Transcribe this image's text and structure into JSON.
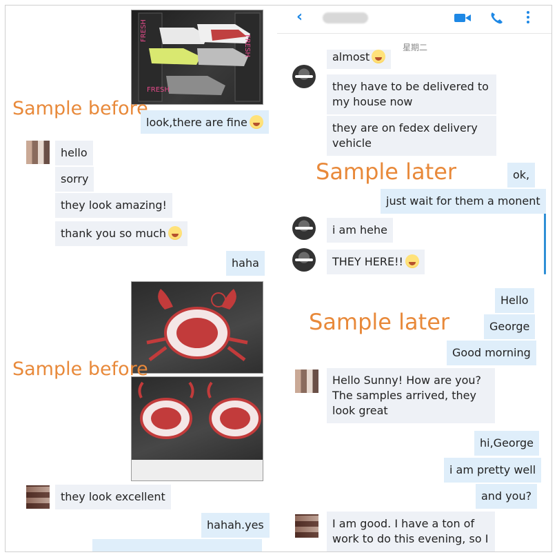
{
  "colors": {
    "caption": "#e8893a",
    "accent": "#1e88e5",
    "bubble_in": "#eef1f6",
    "bubble_out": "#dfeefa"
  },
  "top_left": {
    "caption": "Sample before",
    "messages": [
      {
        "side": "out",
        "text": "look,there are fine"
      },
      {
        "side": "in",
        "text": "hello"
      },
      {
        "side": "in",
        "text": "sorry"
      },
      {
        "side": "in",
        "text": "they look amazing!"
      },
      {
        "side": "in",
        "text": "thank you so much"
      },
      {
        "side": "out",
        "text": "haha"
      }
    ]
  },
  "top_right": {
    "header": {
      "back_icon": "chevron-left-icon",
      "contact_name": "",
      "video_icon": "video-camera-icon",
      "call_icon": "phone-icon",
      "more_icon": "more-vertical-icon"
    },
    "day_label": "星期二",
    "caption": "Sample later",
    "messages": [
      {
        "side": "in",
        "text": "almost"
      },
      {
        "side": "in",
        "text": "they have to be delivered to my house now"
      },
      {
        "side": "in",
        "text": "they are on fedex delivery vehicle"
      },
      {
        "side": "out",
        "text": "ok,"
      },
      {
        "side": "out",
        "text": "just wait for them a monent"
      },
      {
        "side": "in",
        "text": "i am hehe"
      },
      {
        "side": "in",
        "text": "THEY HERE!!"
      }
    ]
  },
  "bottom_left": {
    "caption": "Sample before",
    "messages": [
      {
        "side": "in",
        "text": "they look excellent"
      },
      {
        "side": "out",
        "text": "hahah.yes"
      }
    ]
  },
  "bottom_right": {
    "caption": "Sample later",
    "messages": [
      {
        "side": "out",
        "text": "Hello"
      },
      {
        "side": "out",
        "text": "George"
      },
      {
        "side": "out",
        "text": "Good morning"
      },
      {
        "side": "in",
        "text": "Hello Sunny! How are you? The samples arrived, they look great"
      },
      {
        "side": "out",
        "text": "hi,George"
      },
      {
        "side": "out",
        "text": "i am pretty well"
      },
      {
        "side": "out",
        "text": "and you?"
      },
      {
        "side": "in",
        "text": "I am good. I have a ton of work to do this evening, so I"
      }
    ]
  }
}
